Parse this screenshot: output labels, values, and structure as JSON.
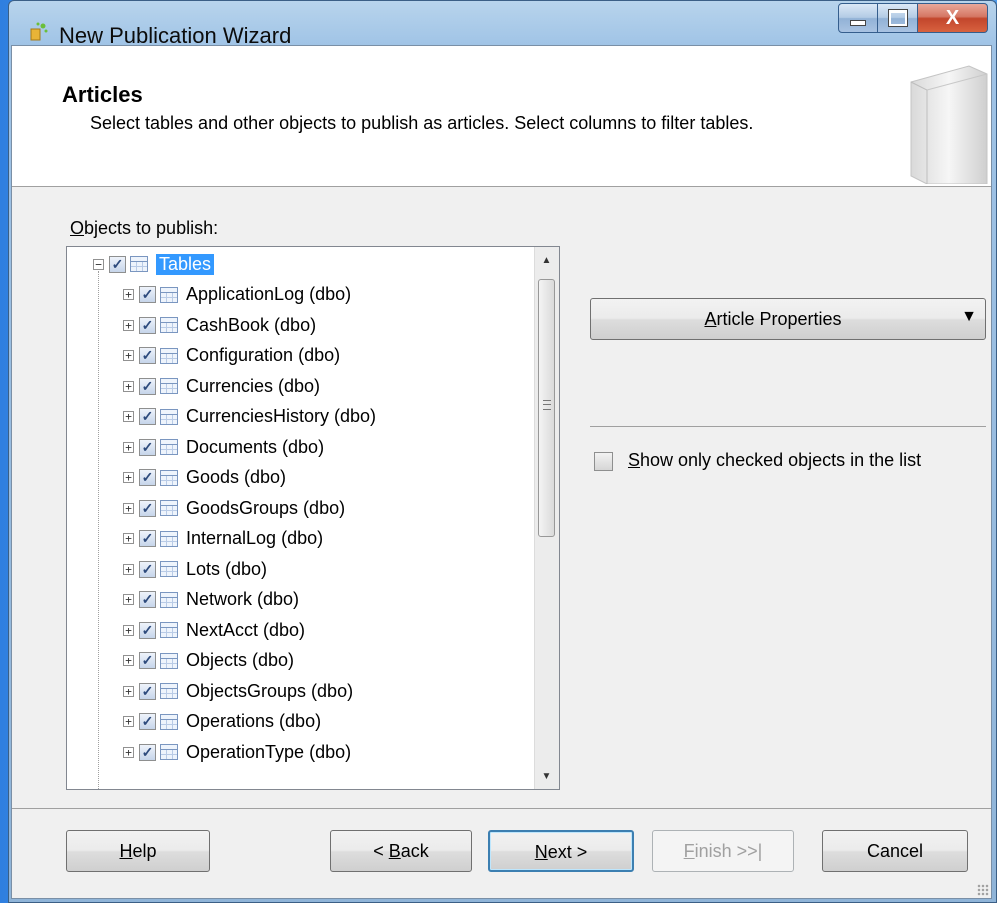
{
  "window": {
    "title": "New Publication Wizard",
    "controls": {
      "minimize": "minimize",
      "maximize": "maximize",
      "close": "X"
    }
  },
  "header": {
    "title": "Articles",
    "description": "Select tables and other objects to publish as articles. Select columns to filter tables."
  },
  "objects_label_prefix": "",
  "objects_label_accel": "O",
  "objects_label_rest": "bjects to publish:",
  "tree": {
    "root": {
      "label": "Tables",
      "checked": true,
      "expanded": true,
      "selected": true
    },
    "items": [
      {
        "label": "ApplicationLog (dbo)",
        "checked": true
      },
      {
        "label": "CashBook (dbo)",
        "checked": true
      },
      {
        "label": "Configuration (dbo)",
        "checked": true
      },
      {
        "label": "Currencies (dbo)",
        "checked": true
      },
      {
        "label": "CurrenciesHistory (dbo)",
        "checked": true
      },
      {
        "label": "Documents (dbo)",
        "checked": true
      },
      {
        "label": "Goods (dbo)",
        "checked": true
      },
      {
        "label": "GoodsGroups (dbo)",
        "checked": true
      },
      {
        "label": "InternalLog (dbo)",
        "checked": true
      },
      {
        "label": "Lots (dbo)",
        "checked": true
      },
      {
        "label": "Network (dbo)",
        "checked": true
      },
      {
        "label": "NextAcct (dbo)",
        "checked": true
      },
      {
        "label": "Objects (dbo)",
        "checked": true
      },
      {
        "label": "ObjectsGroups (dbo)",
        "checked": true
      },
      {
        "label": "Operations (dbo)",
        "checked": true
      },
      {
        "label": "OperationType (dbo)",
        "checked": true
      }
    ]
  },
  "article_properties": {
    "accel": "A",
    "rest": "rticle Properties",
    "arrow": "▼"
  },
  "show_only": {
    "accel": "S",
    "rest": "how only checked objects in the list",
    "checked": false
  },
  "buttons": {
    "help": {
      "accel": "H",
      "rest": "elp"
    },
    "back": {
      "pre": "< ",
      "accel": "B",
      "rest": "ack"
    },
    "next": {
      "accel": "N",
      "rest": "ext >"
    },
    "finish": {
      "accel": "F",
      "rest": "inish >>|",
      "enabled": false
    },
    "cancel": {
      "label": "Cancel"
    }
  },
  "icons": {
    "app": "wizard-app-icon",
    "header": "publication-book-icon",
    "table": "table-icon",
    "expand": "plus-expander-icon",
    "collapse": "minus-expander-icon"
  }
}
